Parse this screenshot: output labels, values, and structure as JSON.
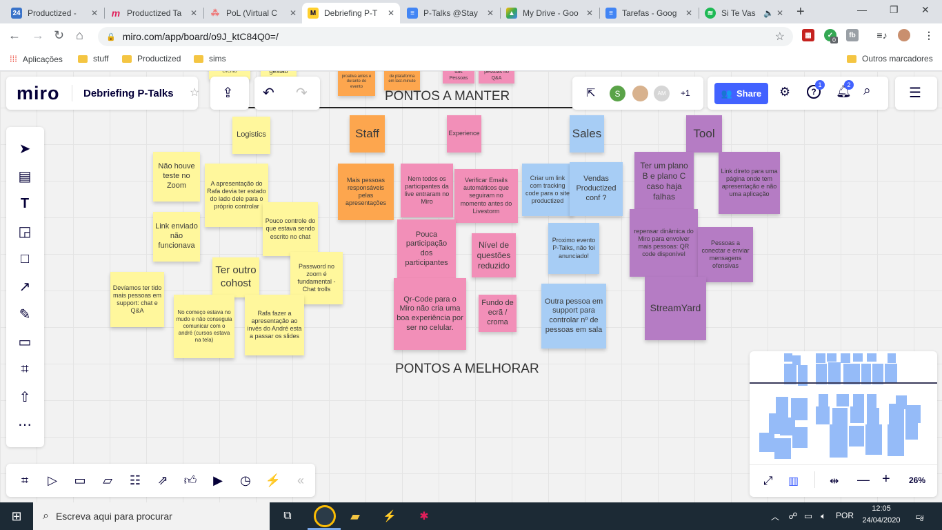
{
  "browser": {
    "tabs": [
      {
        "title": "Productized - ",
        "favicon": "24",
        "color": "#3a73c9"
      },
      {
        "title": "Productized Ta",
        "favicon": "m",
        "color": "#e01e5a"
      },
      {
        "title": "PoL (Virtual C",
        "favicon": "asana",
        "color": "#f06a6a"
      },
      {
        "title": "Debriefing P-T",
        "favicon": "miro",
        "color": "#ffd02f",
        "active": true
      },
      {
        "title": "P-Talks @Stay",
        "favicon": "docs",
        "color": "#4285f4"
      },
      {
        "title": "My Drive - Goo",
        "favicon": "drive",
        "color": "#34a853"
      },
      {
        "title": "Tarefas - Goog",
        "favicon": "docs",
        "color": "#4285f4"
      },
      {
        "title": "Si Te Vas",
        "favicon": "spotify",
        "color": "#1db954"
      }
    ],
    "url": "miro.com/app/board/o9J_ktC84Q0=/",
    "bookmarks": [
      "Aplicações",
      "stuff",
      "Productized",
      "sims"
    ],
    "other_bookmarks": "Outros marcadores",
    "ext_badge": "0"
  },
  "miro": {
    "logo": "miro",
    "board_title": "Debriefing P-Talks",
    "share_label": "Share",
    "collab_initials": [
      "S",
      "AM"
    ],
    "collab_more": "+1",
    "help_badge": "1",
    "notif_badge": "2",
    "zoom": "26%"
  },
  "headings": {
    "manter": "PONTOS A MANTER",
    "melhorar": "PONTOS A MELHORAR"
  },
  "notes": [
    {
      "text": "evento",
      "c": "yellow"
    },
    {
      "text": "gestão",
      "c": "yellow"
    },
    {
      "text": "proativa antes e durante do evento",
      "c": "orange"
    },
    {
      "text": "de plataforma em last-minute",
      "c": "orange"
    },
    {
      "text": "das Pessoas",
      "c": "pink"
    },
    {
      "text": "pessoas no Q&A",
      "c": "pink"
    },
    {
      "text": "Logistics",
      "c": "yellow"
    },
    {
      "text": "Staff",
      "c": "orange"
    },
    {
      "text": "Experience",
      "c": "pink"
    },
    {
      "text": "Sales",
      "c": "blue"
    },
    {
      "text": "Tool",
      "c": "purple"
    },
    {
      "text": "Não houve teste no Zoom",
      "c": "yellow"
    },
    {
      "text": "A apresentação do Rafa devia ter estado do lado dele para o próprio controlar",
      "c": "yellow"
    },
    {
      "text": "Link enviado não funcionava",
      "c": "yellow"
    },
    {
      "text": "Pouco controle do que estava sendo escrito no chat",
      "c": "yellow"
    },
    {
      "text": "Ter outro cohost",
      "c": "yellow"
    },
    {
      "text": "Password no zoom é fundamental - Chat trolls",
      "c": "yellow"
    },
    {
      "text": "Devíamos ter tido mais pessoas em support: chat e Q&A",
      "c": "yellow"
    },
    {
      "text": "No começo estava no mudo e não conseguia comunicar com o andré (cursos estava na tela)",
      "c": "yellow"
    },
    {
      "text": "Rafa fazer a apresentação ao invés do André esta a passar os slides",
      "c": "yellow"
    },
    {
      "text": "Mais pessoas responsáveis pelas apresentações",
      "c": "orange"
    },
    {
      "text": "Nem todos os participantes da live entraram no Miro",
      "c": "pink"
    },
    {
      "text": "Verificar Emails automáticos que seguiram no momento antes do Livestorm",
      "c": "pink"
    },
    {
      "text": "Pouca participação dos participantes",
      "c": "pink"
    },
    {
      "text": "Nível de questões reduzido",
      "c": "pink"
    },
    {
      "text": "Qr-Code para o Miro não cria uma boa experiência por ser no celular.",
      "c": "pink"
    },
    {
      "text": "Fundo de ecrã / croma",
      "c": "pink"
    },
    {
      "text": "Criar um link com tracking code para o site productized",
      "c": "blue"
    },
    {
      "text": "Vendas Productized conf ?",
      "c": "blue"
    },
    {
      "text": "Proximo evento P-Talks, não foi anunciado!",
      "c": "blue"
    },
    {
      "text": "Outra pessoa em support para controlar nº de pessoas em sala",
      "c": "blue"
    },
    {
      "text": "Ter um plano B e plano C caso haja falhas",
      "c": "purple"
    },
    {
      "text": "Link direto para uma página onde tem apresentação e não uma aplicação",
      "c": "purple"
    },
    {
      "text": "repensar dinâmica do Miro para envolver mais pessoas: QR code disponível",
      "c": "purple"
    },
    {
      "text": "Pessoas a conectar e enviar mensagens ofensivas",
      "c": "purple"
    },
    {
      "text": "StreamYard",
      "c": "purple"
    }
  ],
  "taskbar": {
    "search_placeholder": "Escreva aqui para procurar",
    "lang": "POR",
    "time": "12:05",
    "date": "24/04/2020",
    "notif_count": "8"
  }
}
